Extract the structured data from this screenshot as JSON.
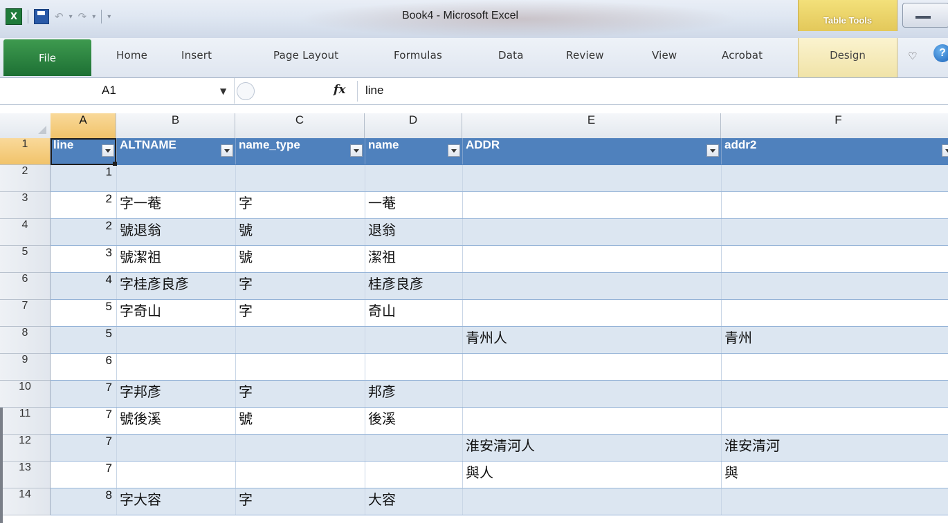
{
  "window": {
    "title": "Book4 - Microsoft Excel",
    "app_icon": "X",
    "contextual_group": "Table Tools"
  },
  "ribbon": {
    "file": "File",
    "tabs": [
      "Home",
      "Insert",
      "Page Layout",
      "Formulas",
      "Data",
      "Review",
      "View",
      "Acrobat",
      "Design"
    ]
  },
  "formula_bar": {
    "name_box": "A1",
    "fx": "fx",
    "content": "line"
  },
  "columns": [
    "A",
    "B",
    "C",
    "D",
    "E",
    "F"
  ],
  "table": {
    "headers": [
      "line",
      "ALTNAME",
      "name_type",
      "name",
      "ADDR",
      "addr2"
    ],
    "rows": [
      {
        "row": "1"
      },
      {
        "row": "2",
        "cells": [
          "1",
          "",
          "",
          "",
          "",
          ""
        ]
      },
      {
        "row": "3",
        "cells": [
          "2",
          "字一菴",
          "字",
          "一菴",
          "",
          ""
        ]
      },
      {
        "row": "4",
        "cells": [
          "2",
          "號退翁",
          "號",
          "退翁",
          "",
          ""
        ]
      },
      {
        "row": "5",
        "cells": [
          "3",
          "號潔祖",
          "號",
          "潔祖",
          "",
          ""
        ]
      },
      {
        "row": "6",
        "cells": [
          "4",
          "字桂彥良彥",
          "字",
          "桂彥良彥",
          "",
          ""
        ]
      },
      {
        "row": "7",
        "cells": [
          "5",
          "字奇山",
          "字",
          "奇山",
          "",
          ""
        ]
      },
      {
        "row": "8",
        "cells": [
          "5",
          "",
          "",
          "",
          "青州人",
          "青州"
        ]
      },
      {
        "row": "9",
        "cells": [
          "6",
          "",
          "",
          "",
          "",
          ""
        ]
      },
      {
        "row": "10",
        "cells": [
          "7",
          "字邦彥",
          "字",
          "邦彥",
          "",
          ""
        ]
      },
      {
        "row": "11",
        "cells": [
          "7",
          "號後溪",
          "號",
          "後溪",
          "",
          ""
        ]
      },
      {
        "row": "12",
        "cells": [
          "7",
          "",
          "",
          "",
          "淮安清河人",
          "淮安清河"
        ]
      },
      {
        "row": "13",
        "cells": [
          "7",
          "",
          "",
          "",
          "與人",
          "與"
        ]
      },
      {
        "row": "14",
        "cells": [
          "8",
          "字大容",
          "字",
          "大容",
          "",
          ""
        ]
      }
    ]
  },
  "colors": {
    "table_header": "#4f81bd",
    "band": "#dce6f1",
    "file_tab": "#1d7034",
    "selection": "#f1c36a"
  }
}
